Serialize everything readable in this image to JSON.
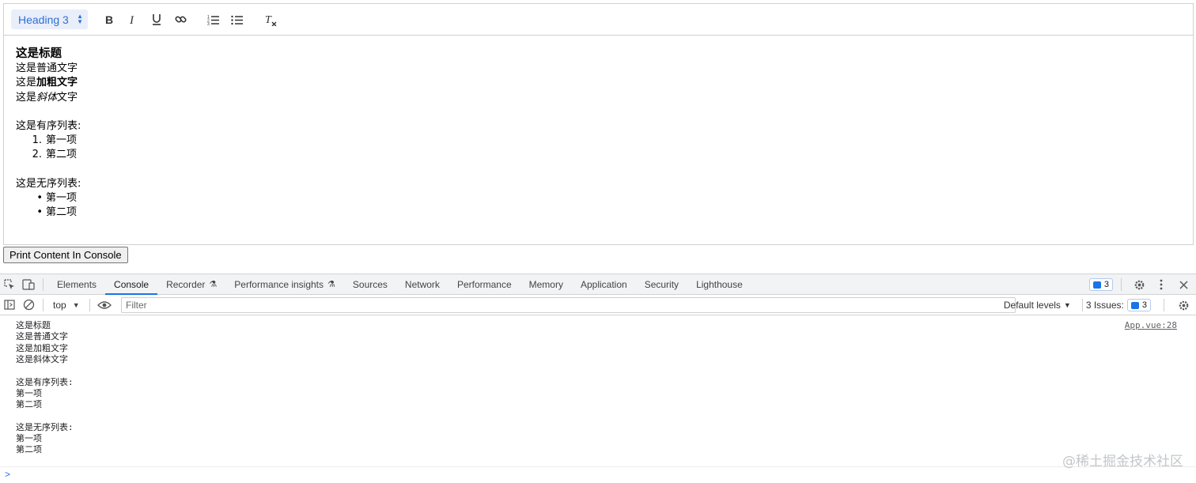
{
  "toolbar": {
    "heading_select": "Heading 3",
    "buttons": [
      "bold",
      "italic",
      "underline",
      "link",
      "ordered-list",
      "bullet-list",
      "clean-format"
    ]
  },
  "editor": {
    "title": "这是标题",
    "normal_text": "这是普通文字",
    "bold_prefix": "这是",
    "bold_text": "加粗文字",
    "italic_prefix": "这是",
    "italic_text": "斜体",
    "italic_suffix": "文字",
    "ordered_label": "这是有序列表:",
    "ordered_items": [
      {
        "marker": "1.",
        "text": "第一项"
      },
      {
        "marker": "2.",
        "text": "第二项"
      }
    ],
    "unordered_label": "这是无序列表:",
    "unordered_items": [
      {
        "marker": "•",
        "text": "第一项"
      },
      {
        "marker": "•",
        "text": "第二项"
      }
    ]
  },
  "print_button": "Print Content In Console",
  "devtools": {
    "tabs": [
      "Elements",
      "Console",
      "Recorder",
      "Performance insights",
      "Sources",
      "Network",
      "Performance",
      "Memory",
      "Application",
      "Security",
      "Lighthouse"
    ],
    "active_tab": "Console",
    "message_badge": "3",
    "context": "top",
    "filter_placeholder": "Filter",
    "default_levels": "Default levels",
    "issues_label": "3 Issues:",
    "issues_count": "3",
    "source_link": "App.vue:28",
    "log_lines": [
      "这是标题",
      "这是普通文字",
      "这是加粗文字",
      "这是斜体文字",
      "",
      "这是有序列表:",
      "第一项",
      "第二项",
      "",
      "这是无序列表:",
      "第一项",
      "第二项"
    ],
    "prompt": ">"
  },
  "watermark": "@稀土掘金技术社区",
  "colors": {
    "accent": "#1a73e8",
    "heading_select_bg": "#e9eefb",
    "heading_select_text": "#2f6fd6"
  }
}
